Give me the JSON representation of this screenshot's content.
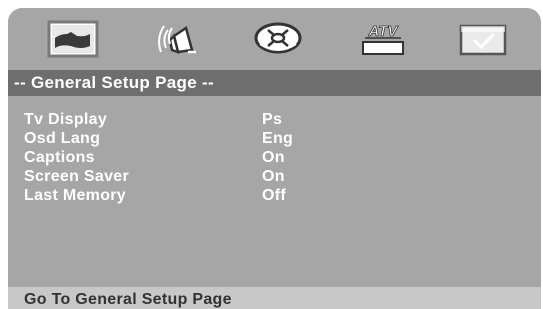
{
  "tabs": [
    {
      "icon": "general-setup-icon",
      "selected": true
    },
    {
      "icon": "audio-speaker-icon",
      "selected": false
    },
    {
      "icon": "video-reel-icon",
      "selected": false
    },
    {
      "icon": "atv-tv-icon",
      "label": "ATV",
      "selected": false
    },
    {
      "icon": "preference-check-icon",
      "selected": false
    }
  ],
  "page": {
    "title": "-- General Setup Page --"
  },
  "settings": [
    {
      "label": "Tv Display",
      "value": "Ps"
    },
    {
      "label": "Osd Lang",
      "value": "Eng"
    },
    {
      "label": "Captions",
      "value": "On"
    },
    {
      "label": "Screen Saver",
      "value": "On"
    },
    {
      "label": "Last Memory",
      "value": "Off"
    }
  ],
  "status": {
    "text": "Go To General Setup Page"
  },
  "colors": {
    "background": "#a6a6a6",
    "title_bar": "#6e6e6e",
    "status_bar": "#c8c8c8",
    "text": "#ffffff"
  }
}
